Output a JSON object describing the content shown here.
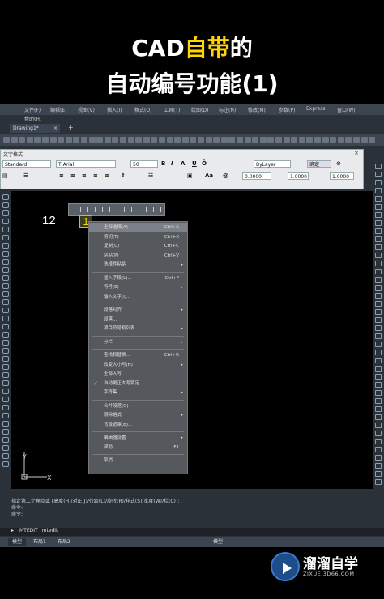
{
  "title_line1_prefix": "CAD",
  "title_line1_highlight": "自带",
  "title_line1_suffix": "的",
  "title_line2": "自动编号功能(1)",
  "menu": [
    "文件(F)",
    "编辑(E)",
    "视图(V)",
    "插入(I)",
    "格式(O)",
    "工具(T)",
    "绘图(D)",
    "标注(N)",
    "修改(M)",
    "参数(P)",
    "Express",
    "窗口(W)"
  ],
  "help_menu": "帮助(H)",
  "tab_name": "Drawing1*",
  "editor": {
    "title": "文字格式",
    "style": "Standard",
    "font": "Arial",
    "height": "50",
    "bold": "B",
    "italic": "I",
    "font2": "A",
    "underline": "U",
    "overline": "Ō",
    "color": "ByLayer",
    "ok": "确定",
    "oblique": "0.0000",
    "tracking": "1.0000",
    "width": "1.0000"
  },
  "drawing_text": "12",
  "cursor_text": "1",
  "context_menu": [
    {
      "label": "全部选择(A)",
      "shortcut": "Ctrl+A",
      "hover": true
    },
    {
      "label": "剪切(T)",
      "shortcut": "Ctrl+X"
    },
    {
      "label": "复制(C)",
      "shortcut": "Ctrl+C"
    },
    {
      "label": "粘贴(P)",
      "shortcut": "Ctrl+V"
    },
    {
      "label": "选择性粘贴",
      "arrow": true
    },
    {
      "sep": true
    },
    {
      "label": "插入字段(L)...",
      "shortcut": "Ctrl+F"
    },
    {
      "label": "符号(S)",
      "arrow": true
    },
    {
      "label": "输入文字(I)..."
    },
    {
      "sep": true
    },
    {
      "label": "段落对齐",
      "arrow": true
    },
    {
      "label": "段落..."
    },
    {
      "label": "项目符号和列表",
      "arrow": true
    },
    {
      "sep": true
    },
    {
      "label": "分栏",
      "arrow": true
    },
    {
      "sep": true
    },
    {
      "label": "查找和替换...",
      "shortcut": "Ctrl+R"
    },
    {
      "label": "改变大小写(H)",
      "arrow": true
    },
    {
      "label": "全部大写"
    },
    {
      "label": "自动更正大写锁定",
      "check": true
    },
    {
      "label": "字符集",
      "arrow": true
    },
    {
      "sep": true
    },
    {
      "label": "合并段落(O)"
    },
    {
      "label": "删除格式",
      "arrow": true
    },
    {
      "label": "背景遮罩(B)..."
    },
    {
      "sep": true
    },
    {
      "label": "编辑器设置",
      "arrow": true
    },
    {
      "label": "帮助",
      "shortcut": "F1"
    },
    {
      "sep": true
    },
    {
      "label": "取消"
    }
  ],
  "ucs_y": "Y",
  "ucs_x": "X",
  "command_lines": [
    "指定第二个角点或 [高度(H)/对正(J)/行距(L)/旋转(R)/样式(S)/宽度(W)/栏(C)]:",
    "命令:",
    "命令:"
  ],
  "command_input": "MTEDIT _mtedit",
  "status_tabs": [
    "模型",
    "布局1",
    "布局2"
  ],
  "status_right": "模型",
  "logo_text": "溜溜自学",
  "logo_url": "ZIXUE.3D66.COM"
}
